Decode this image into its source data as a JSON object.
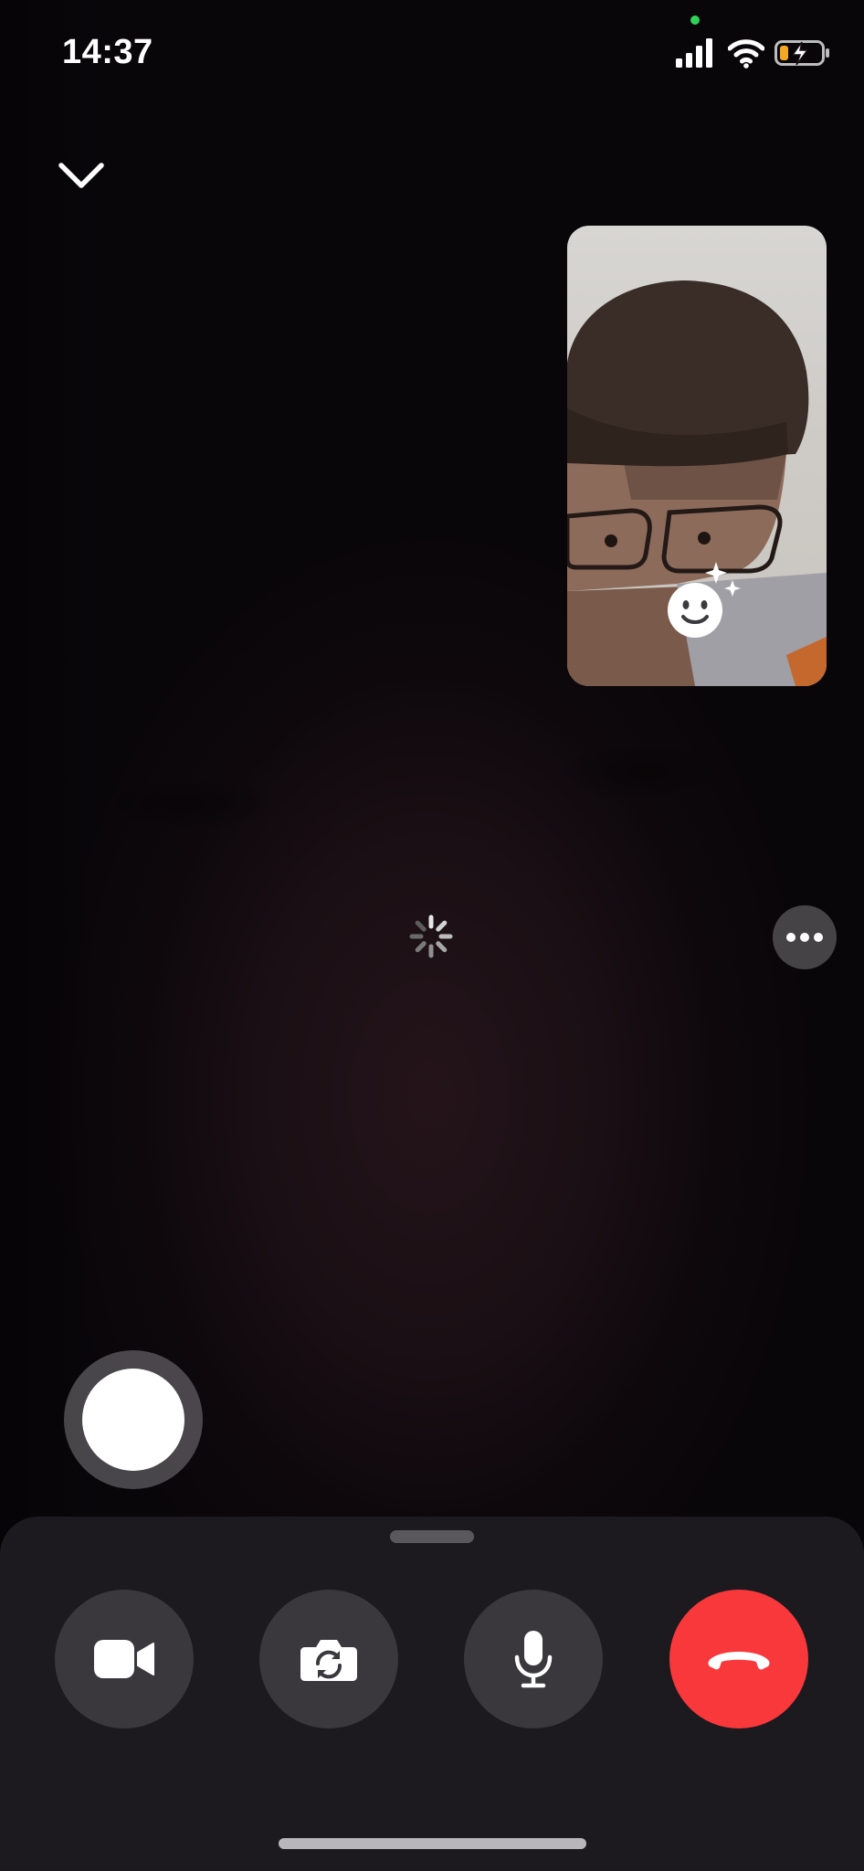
{
  "status_bar": {
    "time": "14:37",
    "signal_icon": "cellular-signal-icon",
    "wifi_icon": "wifi-icon",
    "battery_icon": "battery-charging-icon",
    "battery_level": 0.2,
    "battery_color": "#f5a623",
    "privacy_indicator_color": "#2fd158"
  },
  "top_controls": {
    "collapse_icon": "chevron-down-icon"
  },
  "self_view": {
    "effects_icon": "smiley-sparkle-icon"
  },
  "remote_view": {
    "loading_icon": "spinner-icon"
  },
  "side_controls": {
    "more_icon": "ellipsis-icon",
    "capture_icon": "shutter-icon"
  },
  "call_controls": {
    "buttons": [
      {
        "name": "camera-toggle",
        "icon": "video-camera-icon"
      },
      {
        "name": "flip-camera",
        "icon": "camera-flip-icon"
      },
      {
        "name": "microphone",
        "icon": "microphone-icon"
      },
      {
        "name": "end-call",
        "icon": "phone-hangup-icon"
      }
    ],
    "end_call_color": "#f9383c"
  }
}
